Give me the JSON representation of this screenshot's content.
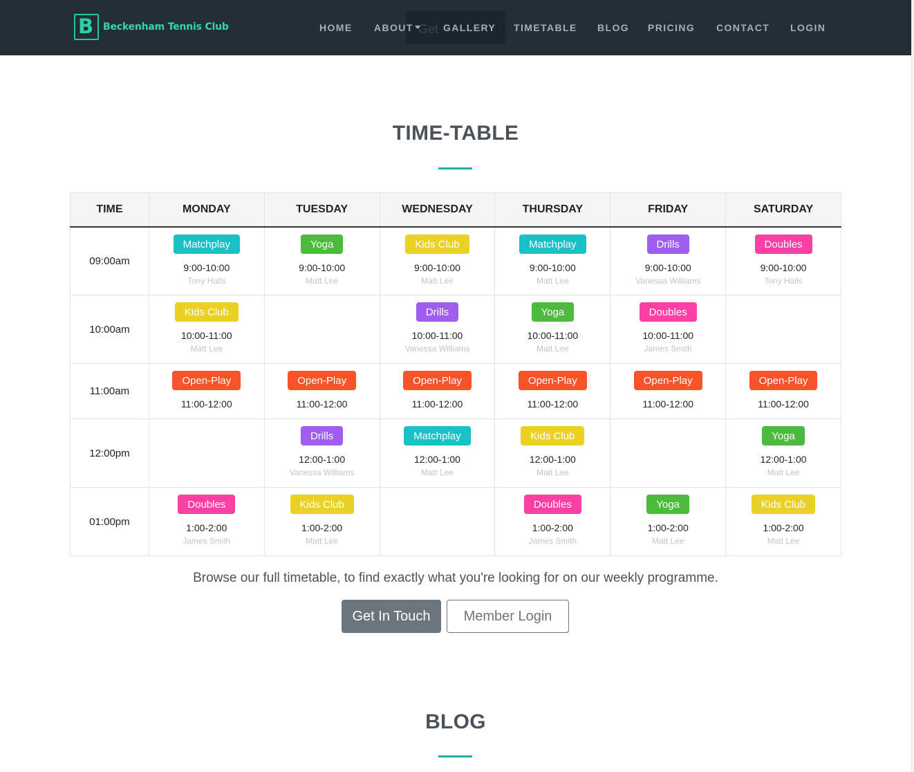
{
  "brand": {
    "letter": "B",
    "name": "Beckenham Tennis Club"
  },
  "nav": {
    "ghost_label": "Get",
    "items": [
      "HOME",
      "ABOUT",
      "GALLERY",
      "TIMETABLE",
      "BLOG",
      "PRICING",
      "CONTACT",
      "LOGIN"
    ]
  },
  "timetable": {
    "title": "TIME-TABLE",
    "headers": [
      "TIME",
      "MONDAY",
      "TUESDAY",
      "WEDNESDAY",
      "THURSDAY",
      "FRIDAY",
      "SATURDAY"
    ],
    "class_colors": {
      "Matchplay": "#17c1c6",
      "Yoga": "#4cba3c",
      "Kids Club": "#ead123",
      "Drills": "#9f5ef0",
      "Doubles": "#fb3fa5",
      "Open-Play": "#f9532a"
    },
    "rows": [
      {
        "time": "09:00am",
        "cells": [
          {
            "class": "Matchplay",
            "slot": "9:00-10:00",
            "coach": "Tony Halls"
          },
          {
            "class": "Yoga",
            "slot": "9:00-10:00",
            "coach": "Matt Lee"
          },
          {
            "class": "Kids Club",
            "slot": "9:00-10:00",
            "coach": "Matt Lee"
          },
          {
            "class": "Matchplay",
            "slot": "9:00-10:00",
            "coach": "Matt Lee"
          },
          {
            "class": "Drills",
            "slot": "9:00-10:00",
            "coach": "Vanessa Williams"
          },
          {
            "class": "Doubles",
            "slot": "9:00-10:00",
            "coach": "Tony Halls"
          }
        ]
      },
      {
        "time": "10:00am",
        "cells": [
          {
            "class": "Kids Club",
            "slot": "10:00-11:00",
            "coach": "Matt Lee"
          },
          null,
          {
            "class": "Drills",
            "slot": "10:00-11:00",
            "coach": "Vanessa Williams"
          },
          {
            "class": "Yoga",
            "slot": "10:00-11:00",
            "coach": "Matt Lee"
          },
          {
            "class": "Doubles",
            "slot": "10:00-11:00",
            "coach": "James Smith"
          },
          null
        ]
      },
      {
        "time": "11:00am",
        "cells": [
          {
            "class": "Open-Play",
            "slot": "11:00-12:00",
            "coach": ""
          },
          {
            "class": "Open-Play",
            "slot": "11:00-12:00",
            "coach": ""
          },
          {
            "class": "Open-Play",
            "slot": "11:00-12:00",
            "coach": ""
          },
          {
            "class": "Open-Play",
            "slot": "11:00-12:00",
            "coach": ""
          },
          {
            "class": "Open-Play",
            "slot": "11:00-12:00",
            "coach": ""
          },
          {
            "class": "Open-Play",
            "slot": "11:00-12:00",
            "coach": ""
          }
        ]
      },
      {
        "time": "12:00pm",
        "cells": [
          null,
          {
            "class": "Drills",
            "slot": "12:00-1:00",
            "coach": "Vanessa Williams"
          },
          {
            "class": "Matchplay",
            "slot": "12:00-1:00",
            "coach": "Matt Lee"
          },
          {
            "class": "Kids Club",
            "slot": "12:00-1:00",
            "coach": "Matt Lee"
          },
          null,
          {
            "class": "Yoga",
            "slot": "12:00-1:00",
            "coach": "Matt Lee"
          }
        ]
      },
      {
        "time": "01:00pm",
        "cells": [
          {
            "class": "Doubles",
            "slot": "1:00-2:00",
            "coach": "James Smith"
          },
          {
            "class": "Kids Club",
            "slot": "1:00-2:00",
            "coach": "Matt Lee"
          },
          null,
          {
            "class": "Doubles",
            "slot": "1:00-2:00",
            "coach": "James Smith"
          },
          {
            "class": "Yoga",
            "slot": "1:00-2:00",
            "coach": "Matt Lee"
          },
          {
            "class": "Kids Club",
            "slot": "1:00-2:00",
            "coach": "Matt Lee"
          }
        ]
      }
    ],
    "browse_text": "Browse our full timetable, to find exactly what you're looking for on our weekly programme.",
    "cta_primary": "Get In Touch",
    "cta_secondary": "Member Login"
  },
  "blog": {
    "title": "BLOG"
  },
  "colors": {
    "navbar": "#232e36",
    "accent": "#20b2aa",
    "brand": "#2fd9ad"
  }
}
